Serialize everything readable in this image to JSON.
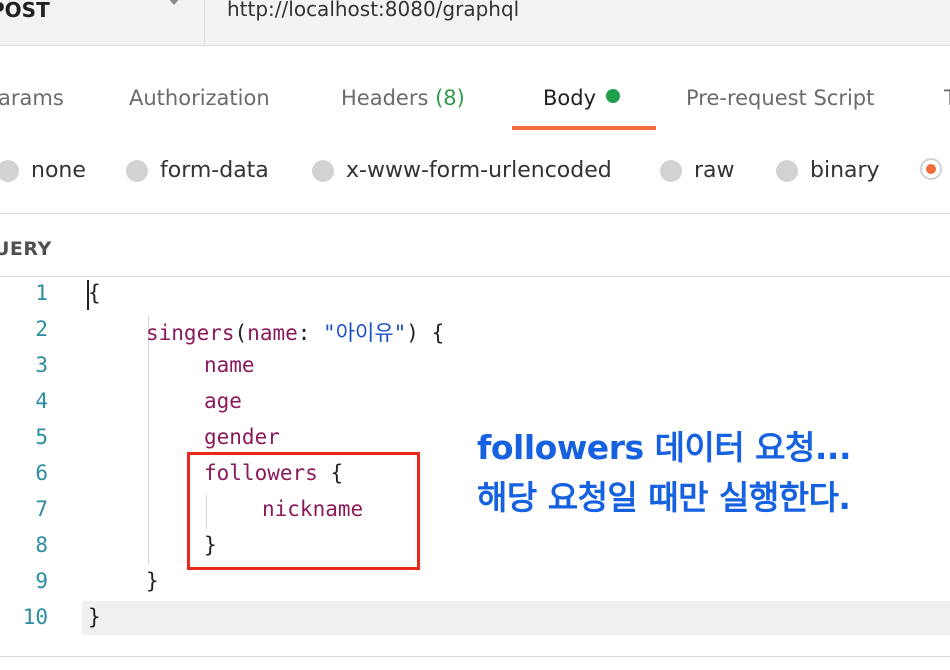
{
  "request": {
    "method": "POST",
    "url": "http://localhost:8080/graphql"
  },
  "tabs": [
    {
      "label": "arams"
    },
    {
      "label": "Authorization"
    },
    {
      "label": "Headers",
      "count": "(8)"
    },
    {
      "label": "Body",
      "active": true
    },
    {
      "label": "Pre-request Script"
    }
  ],
  "body_types": [
    {
      "label": "none"
    },
    {
      "label": "form-data"
    },
    {
      "label": "x-www-form-urlencoded"
    },
    {
      "label": "raw"
    },
    {
      "label": "binary"
    }
  ],
  "editor": {
    "section_label": "UERY",
    "line_numbers": [
      "1",
      "2",
      "3",
      "4",
      "5",
      "6",
      "7",
      "8",
      "9",
      "10"
    ],
    "lines": [
      {
        "code": "{"
      },
      {
        "field": "singers",
        "arg_name": "name",
        "arg_value": "\"아이유\"",
        "close": ") {"
      },
      {
        "field": "name"
      },
      {
        "field": "age"
      },
      {
        "field": "gender"
      },
      {
        "field": "followers",
        "suffix": " {"
      },
      {
        "field": "nickname"
      },
      {
        "code": "}"
      },
      {
        "code": "}"
      },
      {
        "code": "}"
      }
    ]
  },
  "annotation": {
    "line1": "followers 데이터 요청...",
    "line2": "해당 요청일 때만 실행한다.",
    "text_color": "#1561e0",
    "box_color": "#e8291c"
  },
  "colors": {
    "accent": "#f26b3a",
    "active_dot": "#1fa04a",
    "line_number": "#2a8ea0",
    "keyword": "#8a1a5a",
    "string": "#1a4fc8"
  }
}
